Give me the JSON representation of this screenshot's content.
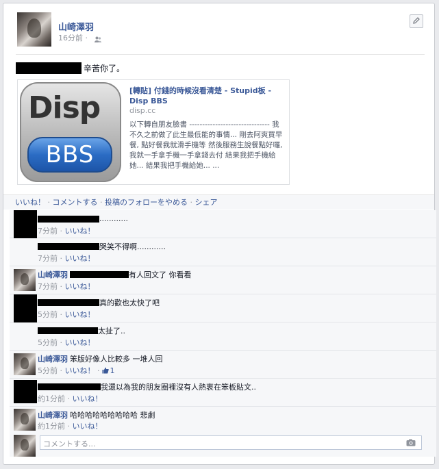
{
  "post": {
    "author": "山崎澤羽",
    "time": "16分前",
    "meta_sep": "·",
    "text": "辛苦你了。",
    "link": {
      "logo_top": "Disp",
      "logo_bottom": "BBS",
      "title": "[轉貼] 付錢的時候沒看清楚 - Stupid板 - Disp BBS",
      "domain": "disp.cc",
      "description": "以下轉自朋友臉書 ------------------------------- 我不久之前做了此生最低能的事情... 剛去阿爽買早餐, 點好餐我就滑手機等 然後服務生說餐點好囉, 我就一手拿手機一手拿錢去付 結果我把手機給她... 結果我把手機給她... ..."
    }
  },
  "actions": {
    "like": "いいね！",
    "comment": "コメントする",
    "unfollow": "投稿のフォローをやめる",
    "share": "シェア",
    "sep": " · "
  },
  "comments": [
    {
      "name": "",
      "text": "............",
      "time": "7分前",
      "like": "いいね！",
      "likes": ""
    },
    {
      "name": "",
      "text": "哭笑不得啊............",
      "time": "7分前",
      "like": "いいね！",
      "likes": ""
    },
    {
      "name": "山崎澤羽",
      "text": "有人回文了 你看看",
      "time": "7分前",
      "like": "いいね！",
      "likes": ""
    },
    {
      "name": "",
      "text": "真的歡也太快了吧",
      "time": "5分前",
      "like": "いいね！",
      "likes": ""
    },
    {
      "name": "",
      "text": "太扯了..",
      "time": "5分前",
      "like": "いいね！",
      "likes": ""
    },
    {
      "name": "山崎澤羽",
      "text": "笨版好像人比較多 一堆人回",
      "time": "5分前",
      "like": "いいね！",
      "likes": "1"
    },
    {
      "name": "",
      "text": "我還以為我的朋友圈裡沒有人熱衷在笨板貼文..",
      "time": "約1分前",
      "like": "いいね！",
      "likes": ""
    },
    {
      "name": "山崎澤羽",
      "text": "哈哈哈哈哈哈哈哈哈 悲劇",
      "time": "約1分前",
      "like": "いいね！",
      "likes": ""
    }
  ],
  "composer": {
    "placeholder": "コメントする..."
  },
  "colors": {
    "link_blue": "#3b5998",
    "meta_gray": "#90949c",
    "bar_bg": "#f6f7f9"
  }
}
